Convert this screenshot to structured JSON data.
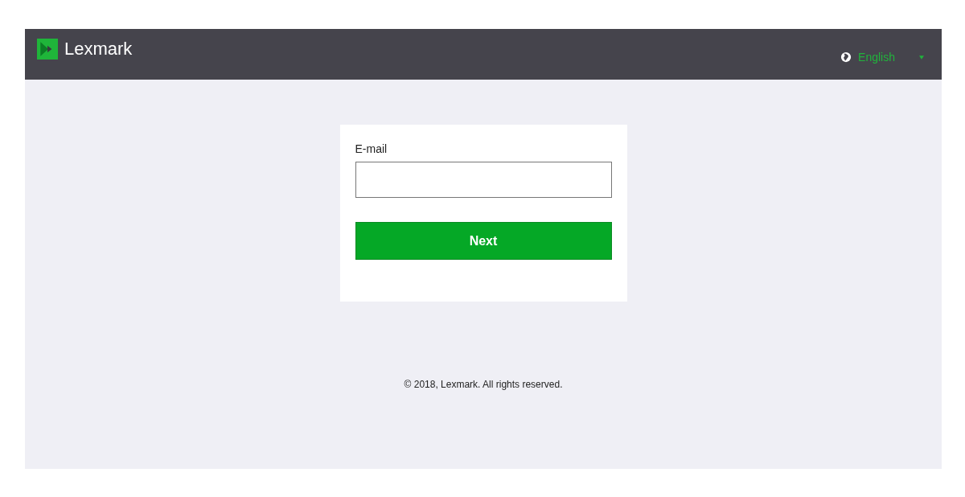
{
  "header": {
    "brand": "Lexmark",
    "language": "English"
  },
  "form": {
    "email_label": "E-mail",
    "next_button": "Next"
  },
  "footer": {
    "copyright": "© 2018, Lexmark. All rights reserved."
  }
}
